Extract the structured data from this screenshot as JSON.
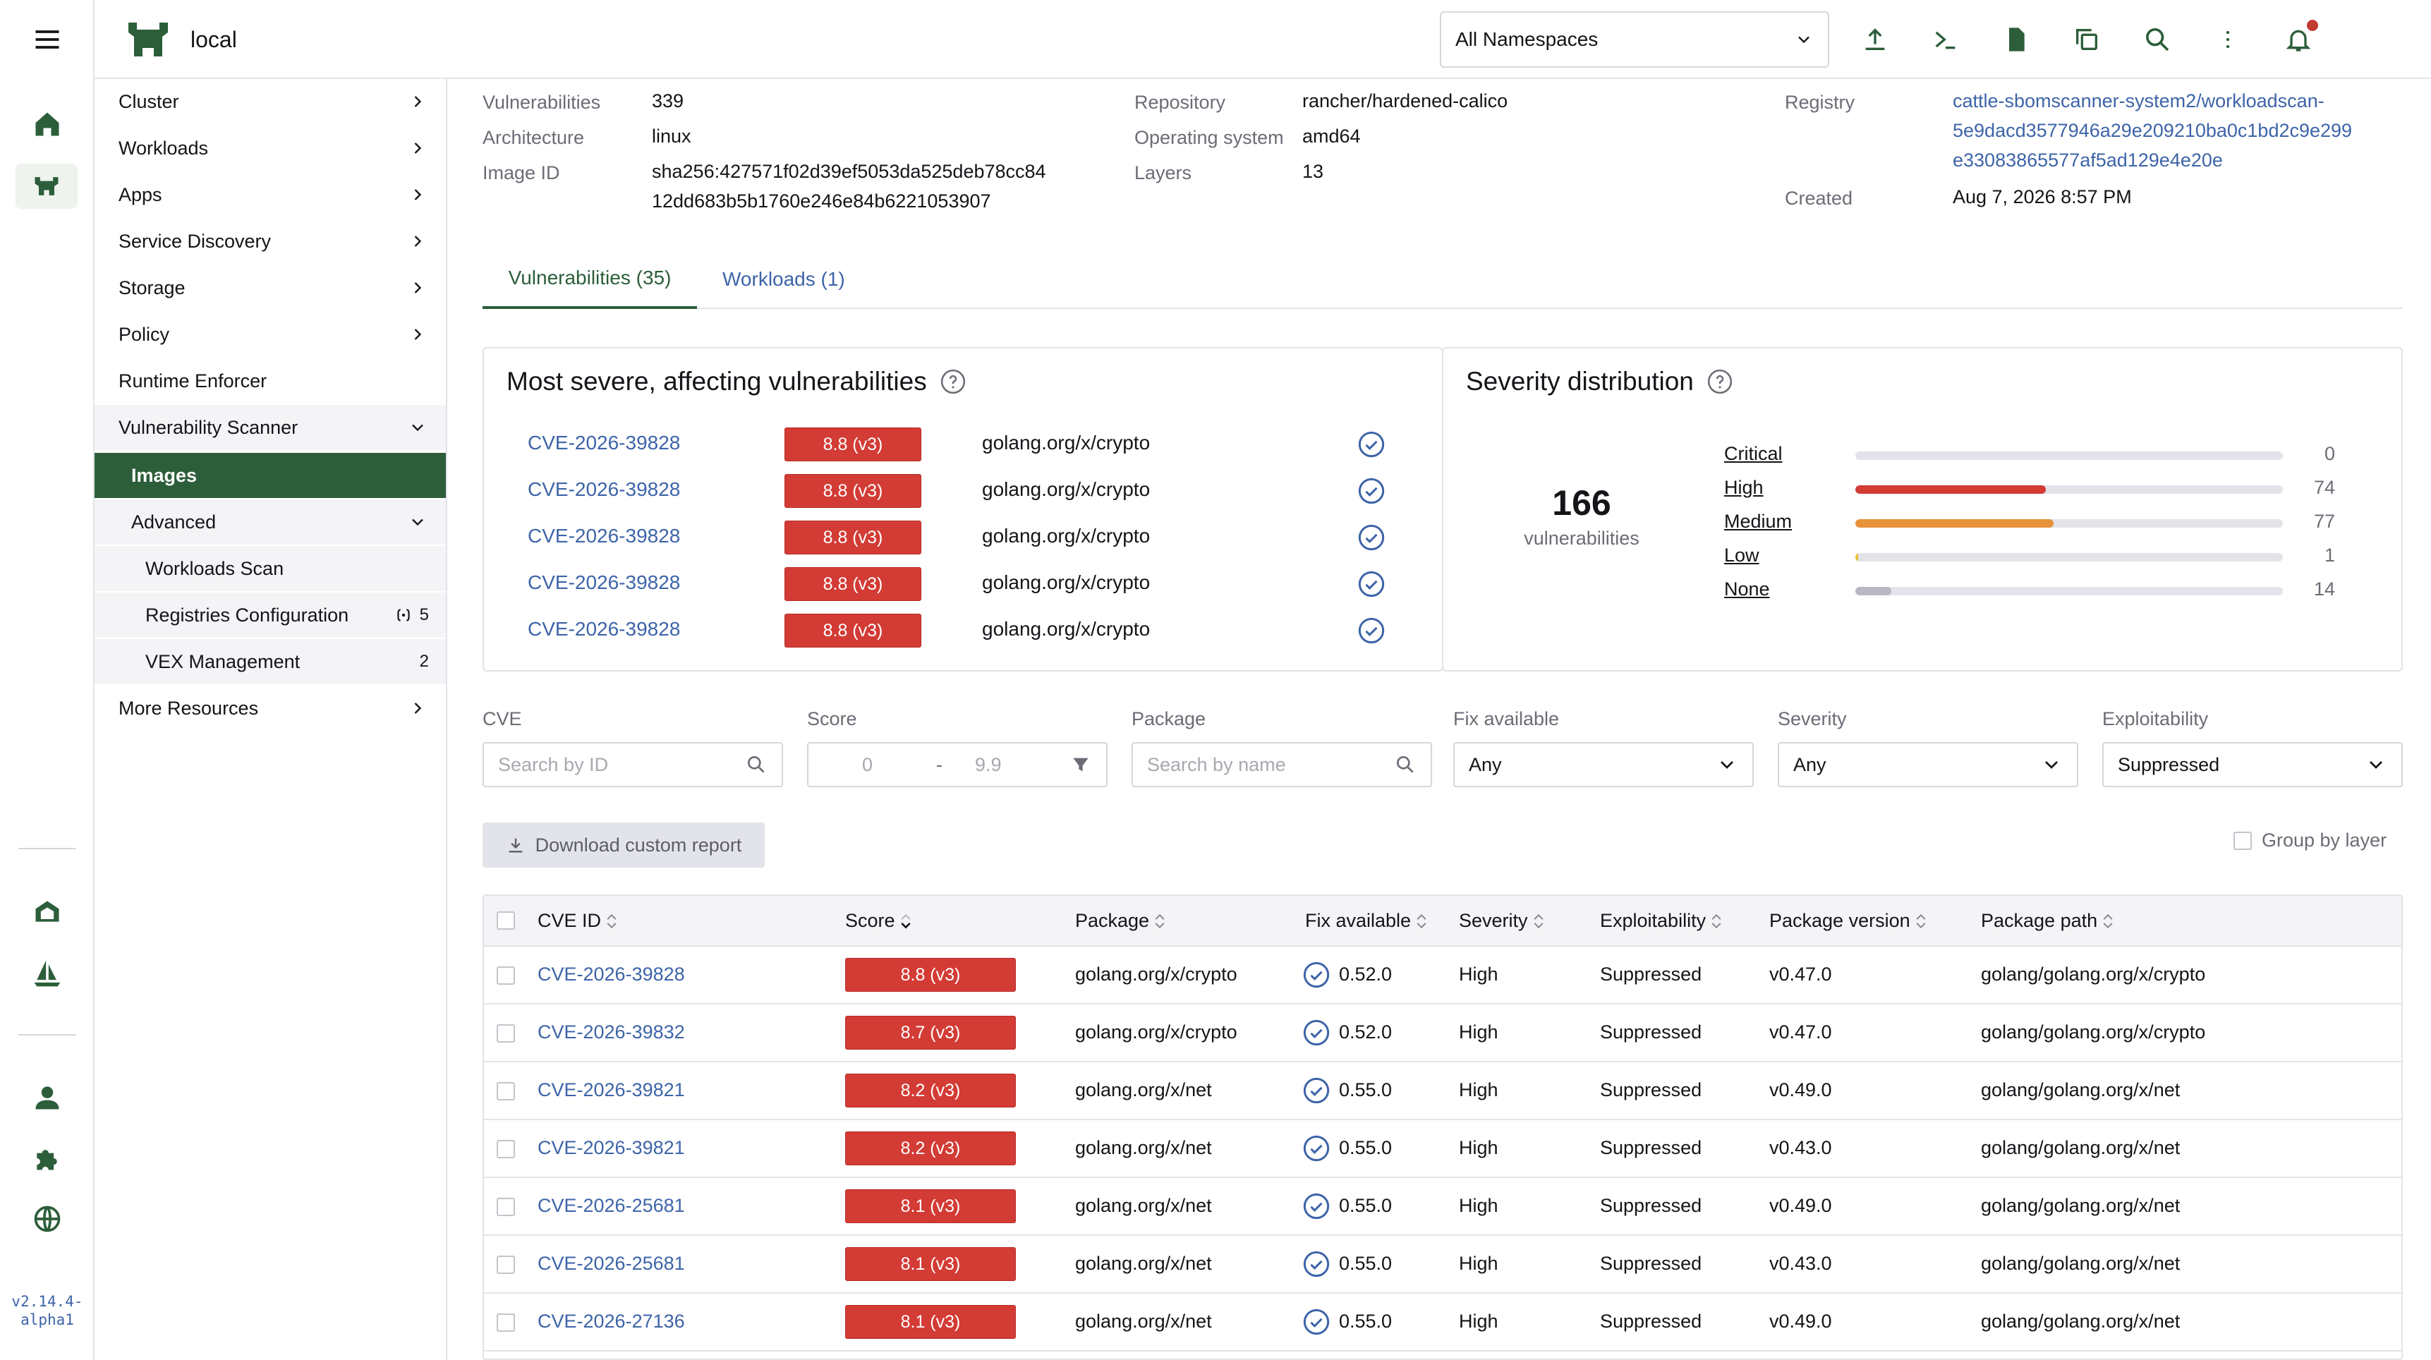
{
  "app": {
    "cluster_name": "local",
    "version": "v2.14.4-\nalpha1",
    "namespace_select": "All Namespaces"
  },
  "sidenav": {
    "items": [
      {
        "label": "Cluster"
      },
      {
        "label": "Workloads"
      },
      {
        "label": "Apps"
      },
      {
        "label": "Service Discovery"
      },
      {
        "label": "Storage"
      },
      {
        "label": "Policy"
      },
      {
        "label": "Runtime Enforcer"
      },
      {
        "label": "Vulnerability Scanner"
      },
      {
        "label": "Images"
      },
      {
        "label": "Advanced"
      },
      {
        "label": "Workloads Scan"
      },
      {
        "label": "Registries Configuration",
        "count": "5"
      },
      {
        "label": "VEX Management",
        "count": "2"
      },
      {
        "label": "More Resources"
      }
    ]
  },
  "image_info": {
    "vulnerabilities_label": "Vulnerabilities",
    "vulnerabilities": "339",
    "architecture_label": "Architecture",
    "architecture": "linux",
    "image_id_label": "Image ID",
    "image_id_line1": "sha256:427571f02d39ef5053da525deb78cc84",
    "image_id_line2": "12dd683b5b1760e246e84b6221053907",
    "repository_label": "Repository",
    "repository": "rancher/hardened-calico",
    "os_label": "Operating system",
    "os": "amd64",
    "layers_label": "Layers",
    "layers": "13",
    "registry_label": "Registry",
    "registry_line1": "cattle-sbomscanner-system2/workloadscan-",
    "registry_line2": "5e9dacd3577946a29e209210ba0c1bd2c9e299",
    "registry_line3": "e33083865577af5ad129e4e20e",
    "created_label": "Created",
    "created": "Aug 7, 2026 8:57 PM"
  },
  "tabs": [
    {
      "label": "Vulnerabilities (35)",
      "active": true
    },
    {
      "label": "Workloads (1)",
      "active": false
    }
  ],
  "most_severe": {
    "title": "Most severe, affecting vulnerabilities",
    "rows": [
      {
        "cve": "CVE-2026-39828",
        "score": "8.8 (v3)",
        "package": "golang.org/x/crypto"
      },
      {
        "cve": "CVE-2026-39828",
        "score": "8.8 (v3)",
        "package": "golang.org/x/crypto"
      },
      {
        "cve": "CVE-2026-39828",
        "score": "8.8 (v3)",
        "package": "golang.org/x/crypto"
      },
      {
        "cve": "CVE-2026-39828",
        "score": "8.8 (v3)",
        "package": "golang.org/x/crypto"
      },
      {
        "cve": "CVE-2026-39828",
        "score": "8.8 (v3)",
        "package": "golang.org/x/crypto"
      }
    ]
  },
  "severity_distribution": {
    "title": "Severity distribution",
    "total": "166",
    "total_label": "vulnerabilities",
    "rows": [
      {
        "label": "Critical",
        "count": 0,
        "fraction": 0.0,
        "color": "#d33b35"
      },
      {
        "label": "High",
        "count": 74,
        "fraction": 0.446,
        "color": "#d33b35"
      },
      {
        "label": "Medium",
        "count": 77,
        "fraction": 0.464,
        "color": "#e8923a"
      },
      {
        "label": "Low",
        "count": 1,
        "fraction": 0.006,
        "color": "#e8c03a"
      },
      {
        "label": "None",
        "count": 14,
        "fraction": 0.084,
        "color": "#b8b8c4"
      }
    ]
  },
  "filters": {
    "cve_label": "CVE",
    "cve_placeholder": "Search by ID",
    "score_label": "Score",
    "score_min": "0",
    "score_sep": "-",
    "score_max": "9.9",
    "package_label": "Package",
    "package_placeholder": "Search by name",
    "fix_label": "Fix available",
    "fix_value": "Any",
    "severity_label": "Severity",
    "severity_value": "Any",
    "exploitability_label": "Exploitability",
    "exploitability_value": "Suppressed"
  },
  "actions": {
    "download_label": "Download custom report",
    "group_by_layer_label": "Group by layer"
  },
  "table": {
    "columns": [
      "CVE ID",
      "Score",
      "Package",
      "Fix available",
      "Severity",
      "Exploitability",
      "Package version",
      "Package path"
    ],
    "rows": [
      {
        "cve": "CVE-2026-39828",
        "score": "8.8 (v3)",
        "package": "golang.org/x/crypto",
        "fix": "0.52.0",
        "severity": "High",
        "exploitability": "Suppressed",
        "version": "v0.47.0",
        "path": "golang/golang.org/x/crypto"
      },
      {
        "cve": "CVE-2026-39832",
        "score": "8.7 (v3)",
        "package": "golang.org/x/crypto",
        "fix": "0.52.0",
        "severity": "High",
        "exploitability": "Suppressed",
        "version": "v0.47.0",
        "path": "golang/golang.org/x/crypto"
      },
      {
        "cve": "CVE-2026-39821",
        "score": "8.2 (v3)",
        "package": "golang.org/x/net",
        "fix": "0.55.0",
        "severity": "High",
        "exploitability": "Suppressed",
        "version": "v0.49.0",
        "path": "golang/golang.org/x/net"
      },
      {
        "cve": "CVE-2026-39821",
        "score": "8.2 (v3)",
        "package": "golang.org/x/net",
        "fix": "0.55.0",
        "severity": "High",
        "exploitability": "Suppressed",
        "version": "v0.43.0",
        "path": "golang/golang.org/x/net"
      },
      {
        "cve": "CVE-2026-25681",
        "score": "8.1 (v3)",
        "package": "golang.org/x/net",
        "fix": "0.55.0",
        "severity": "High",
        "exploitability": "Suppressed",
        "version": "v0.49.0",
        "path": "golang/golang.org/x/net"
      },
      {
        "cve": "CVE-2026-25681",
        "score": "8.1 (v3)",
        "package": "golang.org/x/net",
        "fix": "0.55.0",
        "severity": "High",
        "exploitability": "Suppressed",
        "version": "v0.43.0",
        "path": "golang/golang.org/x/net"
      },
      {
        "cve": "CVE-2026-27136",
        "score": "8.1 (v3)",
        "package": "golang.org/x/net",
        "fix": "0.55.0",
        "severity": "High",
        "exploitability": "Suppressed",
        "version": "v0.49.0",
        "path": "golang/golang.org/x/net"
      }
    ]
  },
  "colors": {
    "brand_green": "#2c5e3a",
    "link_blue": "#3d64a8",
    "score_red": "#d33b35"
  }
}
